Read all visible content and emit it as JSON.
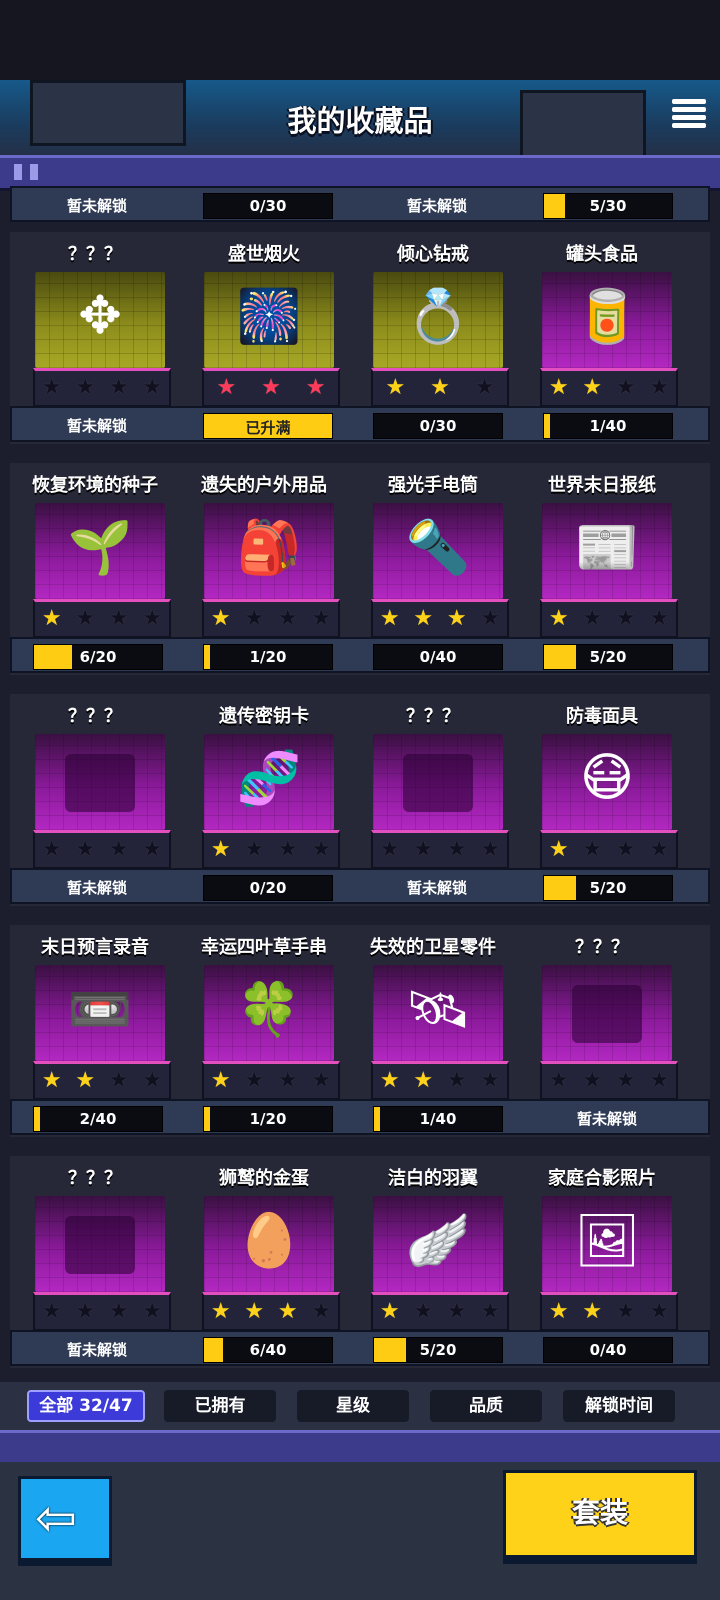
{
  "header": {
    "title": "我的收藏品",
    "menu_icon": "menu-list-icon"
  },
  "top_partial_row": [
    {
      "type": "text",
      "text": "暂未解锁"
    },
    {
      "type": "bar",
      "text": "0/30",
      "progress": 0
    },
    {
      "type": "text",
      "text": "暂未解锁"
    },
    {
      "type": "bar",
      "text": "5/30",
      "progress": 0.167
    }
  ],
  "groups": [
    {
      "items": [
        {
          "name": "？？？",
          "tile": "yellow",
          "icon": "locked-silhouette-icon",
          "glyph": "✥",
          "stars": [
            0,
            0,
            0,
            0
          ],
          "status": {
            "type": "text",
            "text": "暂未解锁"
          }
        },
        {
          "name": "盛世烟火",
          "tile": "yellow",
          "icon": "fireworks-box-icon",
          "glyph": "🎆",
          "stars": [
            2,
            2,
            2
          ],
          "status": {
            "type": "bar",
            "text": "已升满",
            "progress": 1,
            "full": true
          }
        },
        {
          "name": "倾心钻戒",
          "tile": "yellow",
          "icon": "diamond-ring-icon",
          "glyph": "💍",
          "stars": [
            1,
            1,
            0
          ],
          "status": {
            "type": "bar",
            "text": "0/30",
            "progress": 0
          }
        },
        {
          "name": "罐头食品",
          "tile": "purple",
          "icon": "canned-food-icon",
          "glyph": "🥫",
          "stars": [
            1,
            1,
            0,
            0
          ],
          "status": {
            "type": "bar",
            "text": "1/40",
            "progress": 0.025
          }
        }
      ]
    },
    {
      "items": [
        {
          "name": "恢复环境的种子",
          "tile": "purple",
          "icon": "seed-capsule-icon",
          "glyph": "🌱",
          "stars": [
            1,
            0,
            0,
            0
          ],
          "status": {
            "type": "bar",
            "text": "6/20",
            "progress": 0.3
          }
        },
        {
          "name": "遗失的户外用品",
          "tile": "purple",
          "icon": "backpack-icon",
          "glyph": "🎒",
          "stars": [
            1,
            0,
            0,
            0
          ],
          "status": {
            "type": "bar",
            "text": "1/20",
            "progress": 0.05
          }
        },
        {
          "name": "强光手电筒",
          "tile": "purple",
          "icon": "flashlight-icon",
          "glyph": "🔦",
          "stars": [
            1,
            1,
            1,
            0
          ],
          "status": {
            "type": "bar",
            "text": "0/40",
            "progress": 0
          }
        },
        {
          "name": "世界末日报纸",
          "tile": "purple",
          "icon": "newspaper-icon",
          "glyph": "📰",
          "stars": [
            1,
            0,
            0,
            0
          ],
          "status": {
            "type": "bar",
            "text": "5/20",
            "progress": 0.25
          }
        }
      ]
    },
    {
      "items": [
        {
          "name": "？？？",
          "tile": "purple",
          "icon": "locked-silhouette-icon",
          "glyph": "",
          "stars": [
            0,
            0,
            0,
            0
          ],
          "status": {
            "type": "text",
            "text": "暂未解锁"
          }
        },
        {
          "name": "遗传密钥卡",
          "tile": "purple",
          "icon": "dna-keycard-icon",
          "glyph": "🧬",
          "stars": [
            1,
            0,
            0,
            0
          ],
          "status": {
            "type": "bar",
            "text": "0/20",
            "progress": 0
          }
        },
        {
          "name": "？？？",
          "tile": "purple",
          "icon": "locked-silhouette-icon",
          "glyph": "",
          "stars": [
            0,
            0,
            0,
            0
          ],
          "status": {
            "type": "text",
            "text": "暂未解锁"
          }
        },
        {
          "name": "防毒面具",
          "tile": "purple",
          "icon": "gas-mask-icon",
          "glyph": "😷",
          "stars": [
            1,
            0,
            0,
            0
          ],
          "status": {
            "type": "bar",
            "text": "5/20",
            "progress": 0.25
          }
        }
      ]
    },
    {
      "items": [
        {
          "name": "末日预言录音",
          "tile": "purple",
          "icon": "cassette-tape-icon",
          "glyph": "📼",
          "stars": [
            1,
            1,
            0,
            0
          ],
          "status": {
            "type": "bar",
            "text": "2/40",
            "progress": 0.05
          }
        },
        {
          "name": "幸运四叶草手串",
          "tile": "purple",
          "icon": "four-leaf-clover-icon",
          "glyph": "🍀",
          "stars": [
            1,
            0,
            0,
            0
          ],
          "status": {
            "type": "bar",
            "text": "1/20",
            "progress": 0.05
          }
        },
        {
          "name": "失效的卫星零件",
          "tile": "purple",
          "icon": "satellite-part-icon",
          "glyph": "🛰",
          "stars": [
            1,
            1,
            0,
            0
          ],
          "status": {
            "type": "bar",
            "text": "1/40",
            "progress": 0.025
          }
        },
        {
          "name": "？？？",
          "tile": "purple",
          "icon": "locked-silhouette-icon",
          "glyph": "",
          "stars": [
            0,
            0,
            0,
            0
          ],
          "status": {
            "type": "text",
            "text": "暂未解锁"
          }
        }
      ]
    },
    {
      "items": [
        {
          "name": "？？？",
          "tile": "purple",
          "icon": "locked-silhouette-icon",
          "glyph": "",
          "stars": [
            0,
            0,
            0,
            0
          ],
          "status": {
            "type": "text",
            "text": "暂未解锁"
          }
        },
        {
          "name": "狮鹫的金蛋",
          "tile": "purple",
          "icon": "golden-egg-icon",
          "glyph": "🥚",
          "stars": [
            1,
            1,
            1,
            0
          ],
          "status": {
            "type": "bar",
            "text": "6/40",
            "progress": 0.15
          }
        },
        {
          "name": "洁白的羽翼",
          "tile": "purple",
          "icon": "white-wing-icon",
          "glyph": "🪽",
          "stars": [
            1,
            0,
            0,
            0
          ],
          "status": {
            "type": "bar",
            "text": "5/20",
            "progress": 0.25
          }
        },
        {
          "name": "家庭合影照片",
          "tile": "purple",
          "icon": "family-photo-icon",
          "glyph": "🖼",
          "stars": [
            1,
            1,
            0,
            0
          ],
          "status": {
            "type": "bar",
            "text": "0/40",
            "progress": 0
          }
        }
      ]
    }
  ],
  "filters": [
    {
      "label": "全部 32/47",
      "active": true
    },
    {
      "label": "已拥有",
      "active": false
    },
    {
      "label": "星级",
      "active": false
    },
    {
      "label": "品质",
      "active": false
    },
    {
      "label": "解锁时间",
      "active": false
    }
  ],
  "bottom": {
    "back_icon": "back-arrow-icon",
    "back_glyph": "⇦",
    "suit_label": "套装"
  },
  "colors": {
    "accent_yellow": "#ffd21a",
    "accent_blue": "#1aa6f0",
    "filter_active": "#3c3ad8"
  }
}
